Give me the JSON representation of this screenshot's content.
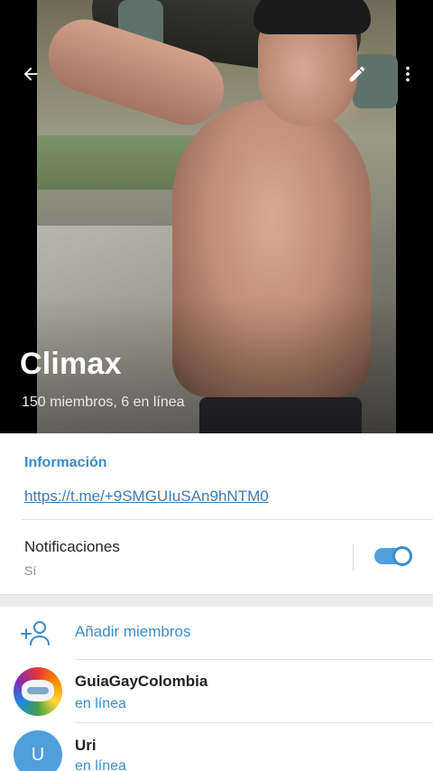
{
  "header": {
    "title": "Climax",
    "subtitle": "150 miembros, 6 en línea",
    "back_icon": "arrow-left-icon",
    "edit_icon": "pencil-icon",
    "more_icon": "more-vertical-icon"
  },
  "info": {
    "label": "Información",
    "link": "https://t.me/+9SMGUIuSAn9hNTM0"
  },
  "notifications": {
    "label": "Notificaciones",
    "value": "Sí",
    "enabled": true
  },
  "members": {
    "add_label": "Añadir miembros",
    "add_icon": "add-user-icon",
    "list": [
      {
        "name": "GuiaGayColombia",
        "status": "en línea"
      },
      {
        "name": "Uri",
        "status": "en línea",
        "initial": "U"
      }
    ]
  },
  "colors": {
    "accent": "#3a8cc9",
    "toggle_track": "#4ea0dd",
    "avatar_blue": "#4f9fdc"
  }
}
